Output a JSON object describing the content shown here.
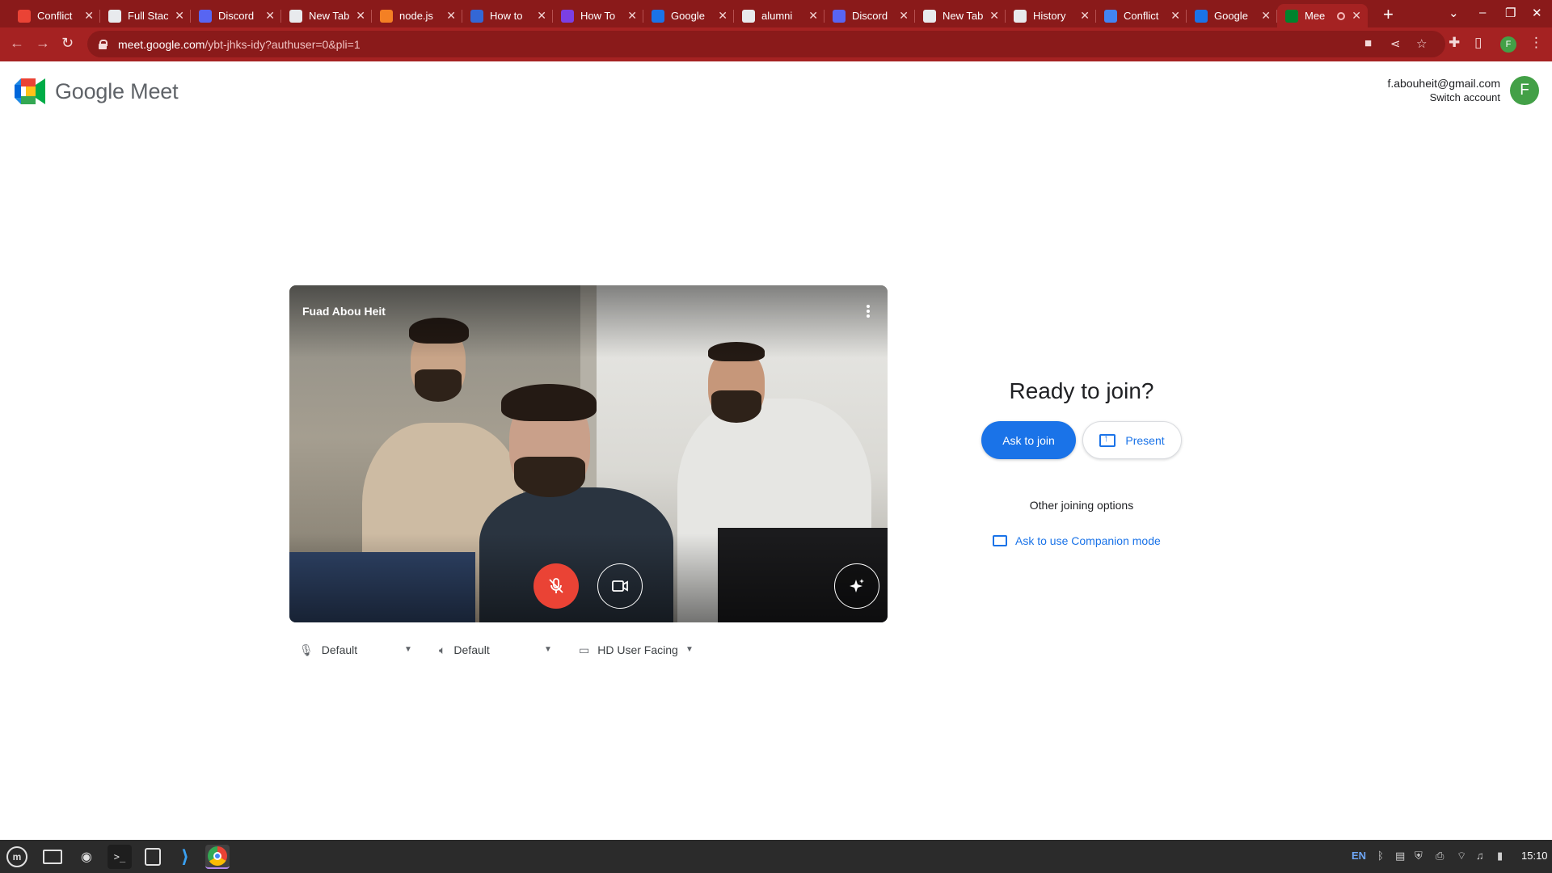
{
  "browser": {
    "tabs": [
      {
        "title": "Conflict",
        "favicon": "gmail-icon",
        "color": "#ea4335"
      },
      {
        "title": "Full Stac",
        "favicon": "document-icon",
        "color": "#e8eaed"
      },
      {
        "title": "Discord",
        "favicon": "discord-icon",
        "color": "#5865f2"
      },
      {
        "title": "New Tab",
        "favicon": "chrome-icon",
        "color": "#e8eaed"
      },
      {
        "title": "node.js",
        "favicon": "stackoverflow-icon",
        "color": "#f48024"
      },
      {
        "title": "How to",
        "favicon": "globe-icon",
        "color": "#3367d6"
      },
      {
        "title": "How To",
        "favicon": "k-icon",
        "color": "#7b3fe4"
      },
      {
        "title": "Google",
        "favicon": "google-sheets-icon",
        "color": "#1a73e8"
      },
      {
        "title": "alumni",
        "favicon": "google-icon",
        "color": "#e8eaed"
      },
      {
        "title": "Discord",
        "favicon": "discord-icon",
        "color": "#5865f2"
      },
      {
        "title": "New Tab",
        "favicon": "chrome-icon",
        "color": "#e8eaed"
      },
      {
        "title": "History",
        "favicon": "history-icon",
        "color": "#e8eaed"
      },
      {
        "title": "Conflict",
        "favicon": "google-docs-icon",
        "color": "#4285f4"
      },
      {
        "title": "Google",
        "favicon": "google-sheets-icon",
        "color": "#1a73e8"
      },
      {
        "title": "Mee",
        "favicon": "meet-icon",
        "color": "#00832d",
        "active": true
      }
    ],
    "url_host": "meet.google.com",
    "url_path": "/ybt-jhks-idy?authuser=0&pli=1",
    "profile_initial": "F"
  },
  "meet": {
    "logo_text": "Google Meet",
    "account_email": "f.abouheit@gmail.com",
    "switch_account": "Switch account",
    "avatar_initial": "F",
    "preview_name": "Fuad Abou Heit",
    "mic_muted": true,
    "ready_title": "Ready to join?",
    "ask_to_join": "Ask to join",
    "present": "Present",
    "other_options": "Other joining options",
    "companion_mode": "Ask to use Companion mode",
    "devices": {
      "microphone": "Default",
      "speaker": "Default",
      "camera": "HD User Facing"
    },
    "colors": {
      "primary": "#1a73e8",
      "mic_muted": "#ea4335",
      "chrome_theme": "#a52222"
    }
  },
  "taskbar": {
    "language": "EN",
    "clock": "15:10"
  }
}
